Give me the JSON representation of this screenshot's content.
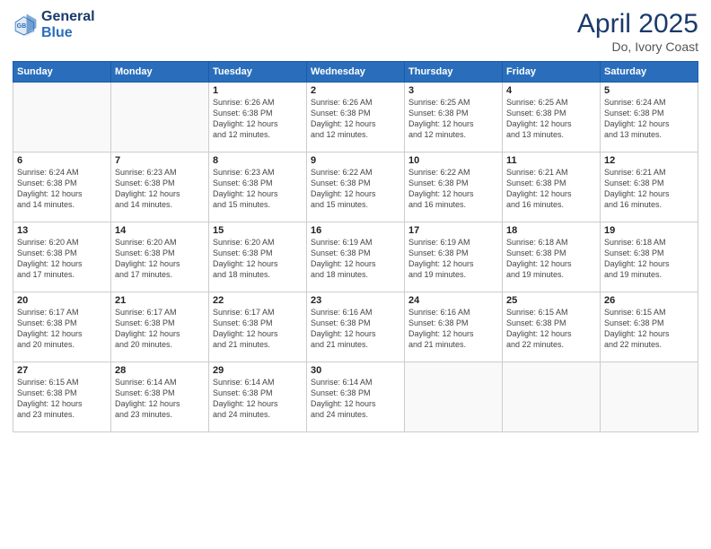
{
  "logo": {
    "line1": "General",
    "line2": "Blue"
  },
  "title": "April 2025",
  "location": "Do, Ivory Coast",
  "days_header": [
    "Sunday",
    "Monday",
    "Tuesday",
    "Wednesday",
    "Thursday",
    "Friday",
    "Saturday"
  ],
  "weeks": [
    [
      {
        "day": "",
        "info": ""
      },
      {
        "day": "",
        "info": ""
      },
      {
        "day": "1",
        "info": "Sunrise: 6:26 AM\nSunset: 6:38 PM\nDaylight: 12 hours\nand 12 minutes."
      },
      {
        "day": "2",
        "info": "Sunrise: 6:26 AM\nSunset: 6:38 PM\nDaylight: 12 hours\nand 12 minutes."
      },
      {
        "day": "3",
        "info": "Sunrise: 6:25 AM\nSunset: 6:38 PM\nDaylight: 12 hours\nand 12 minutes."
      },
      {
        "day": "4",
        "info": "Sunrise: 6:25 AM\nSunset: 6:38 PM\nDaylight: 12 hours\nand 13 minutes."
      },
      {
        "day": "5",
        "info": "Sunrise: 6:24 AM\nSunset: 6:38 PM\nDaylight: 12 hours\nand 13 minutes."
      }
    ],
    [
      {
        "day": "6",
        "info": "Sunrise: 6:24 AM\nSunset: 6:38 PM\nDaylight: 12 hours\nand 14 minutes."
      },
      {
        "day": "7",
        "info": "Sunrise: 6:23 AM\nSunset: 6:38 PM\nDaylight: 12 hours\nand 14 minutes."
      },
      {
        "day": "8",
        "info": "Sunrise: 6:23 AM\nSunset: 6:38 PM\nDaylight: 12 hours\nand 15 minutes."
      },
      {
        "day": "9",
        "info": "Sunrise: 6:22 AM\nSunset: 6:38 PM\nDaylight: 12 hours\nand 15 minutes."
      },
      {
        "day": "10",
        "info": "Sunrise: 6:22 AM\nSunset: 6:38 PM\nDaylight: 12 hours\nand 16 minutes."
      },
      {
        "day": "11",
        "info": "Sunrise: 6:21 AM\nSunset: 6:38 PM\nDaylight: 12 hours\nand 16 minutes."
      },
      {
        "day": "12",
        "info": "Sunrise: 6:21 AM\nSunset: 6:38 PM\nDaylight: 12 hours\nand 16 minutes."
      }
    ],
    [
      {
        "day": "13",
        "info": "Sunrise: 6:20 AM\nSunset: 6:38 PM\nDaylight: 12 hours\nand 17 minutes."
      },
      {
        "day": "14",
        "info": "Sunrise: 6:20 AM\nSunset: 6:38 PM\nDaylight: 12 hours\nand 17 minutes."
      },
      {
        "day": "15",
        "info": "Sunrise: 6:20 AM\nSunset: 6:38 PM\nDaylight: 12 hours\nand 18 minutes."
      },
      {
        "day": "16",
        "info": "Sunrise: 6:19 AM\nSunset: 6:38 PM\nDaylight: 12 hours\nand 18 minutes."
      },
      {
        "day": "17",
        "info": "Sunrise: 6:19 AM\nSunset: 6:38 PM\nDaylight: 12 hours\nand 19 minutes."
      },
      {
        "day": "18",
        "info": "Sunrise: 6:18 AM\nSunset: 6:38 PM\nDaylight: 12 hours\nand 19 minutes."
      },
      {
        "day": "19",
        "info": "Sunrise: 6:18 AM\nSunset: 6:38 PM\nDaylight: 12 hours\nand 19 minutes."
      }
    ],
    [
      {
        "day": "20",
        "info": "Sunrise: 6:17 AM\nSunset: 6:38 PM\nDaylight: 12 hours\nand 20 minutes."
      },
      {
        "day": "21",
        "info": "Sunrise: 6:17 AM\nSunset: 6:38 PM\nDaylight: 12 hours\nand 20 minutes."
      },
      {
        "day": "22",
        "info": "Sunrise: 6:17 AM\nSunset: 6:38 PM\nDaylight: 12 hours\nand 21 minutes."
      },
      {
        "day": "23",
        "info": "Sunrise: 6:16 AM\nSunset: 6:38 PM\nDaylight: 12 hours\nand 21 minutes."
      },
      {
        "day": "24",
        "info": "Sunrise: 6:16 AM\nSunset: 6:38 PM\nDaylight: 12 hours\nand 21 minutes."
      },
      {
        "day": "25",
        "info": "Sunrise: 6:15 AM\nSunset: 6:38 PM\nDaylight: 12 hours\nand 22 minutes."
      },
      {
        "day": "26",
        "info": "Sunrise: 6:15 AM\nSunset: 6:38 PM\nDaylight: 12 hours\nand 22 minutes."
      }
    ],
    [
      {
        "day": "27",
        "info": "Sunrise: 6:15 AM\nSunset: 6:38 PM\nDaylight: 12 hours\nand 23 minutes."
      },
      {
        "day": "28",
        "info": "Sunrise: 6:14 AM\nSunset: 6:38 PM\nDaylight: 12 hours\nand 23 minutes."
      },
      {
        "day": "29",
        "info": "Sunrise: 6:14 AM\nSunset: 6:38 PM\nDaylight: 12 hours\nand 24 minutes."
      },
      {
        "day": "30",
        "info": "Sunrise: 6:14 AM\nSunset: 6:38 PM\nDaylight: 12 hours\nand 24 minutes."
      },
      {
        "day": "",
        "info": ""
      },
      {
        "day": "",
        "info": ""
      },
      {
        "day": "",
        "info": ""
      }
    ]
  ]
}
